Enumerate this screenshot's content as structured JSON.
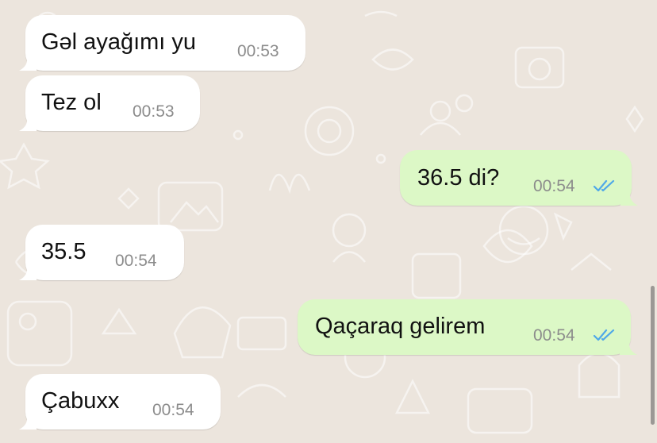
{
  "chat": {
    "messages": [
      {
        "direction": "incoming",
        "text": "Gəl ayağımı yu",
        "time": "00:53"
      },
      {
        "direction": "incoming",
        "text": "Tez ol",
        "time": "00:53"
      },
      {
        "direction": "outgoing",
        "text": "36.5 di?",
        "time": "00:54",
        "status_icon": "double-check-read-icon"
      },
      {
        "direction": "incoming",
        "text": "35.5",
        "time": "00:54"
      },
      {
        "direction": "outgoing",
        "text": "Qaçaraq gelirem",
        "time": "00:54",
        "status_icon": "double-check-read-icon"
      },
      {
        "direction": "incoming",
        "text": "Çabuxx",
        "time": "00:54"
      }
    ]
  },
  "colors": {
    "background": "#ece5dd",
    "incoming_bubble": "#ffffff",
    "outgoing_bubble": "#dcf8c6",
    "read_ticks": "#4fa8e8",
    "timestamp": "#8c8c8c"
  }
}
